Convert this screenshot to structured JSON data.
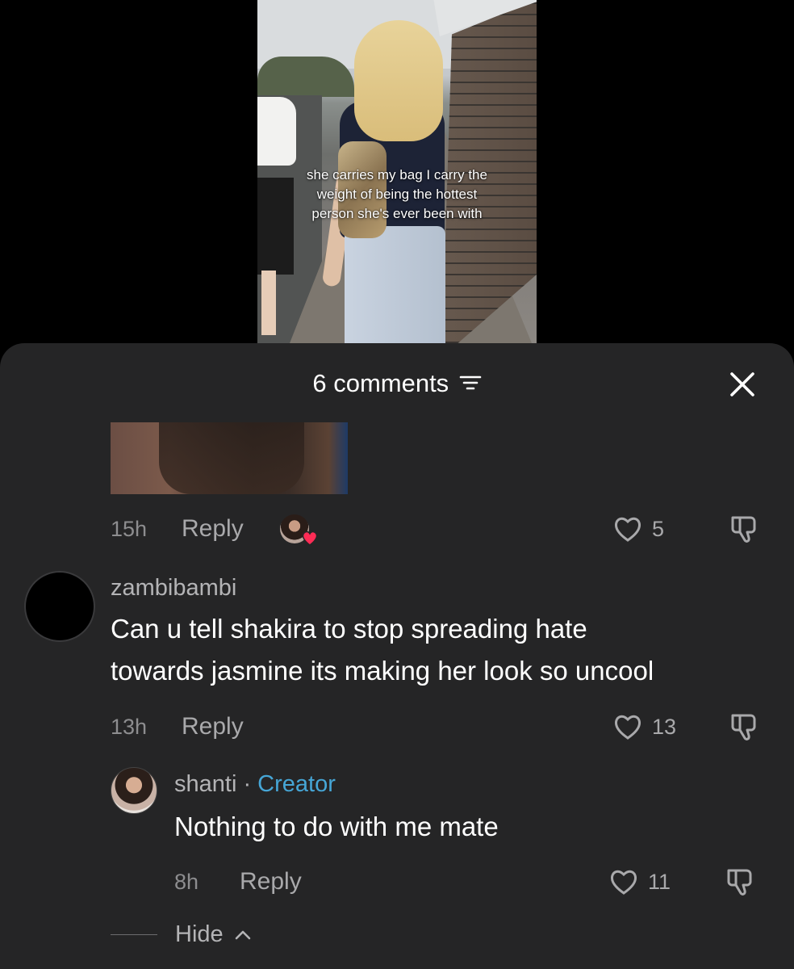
{
  "video": {
    "caption_lines": [
      "she carries my bag I carry the",
      "weight of being the hottest",
      "person she's ever been with"
    ]
  },
  "sheet": {
    "comment_count": "6 comments",
    "filter_icon": "filter-sort-icon",
    "close_icon": "close-icon"
  },
  "comments": [
    {
      "time": "15h",
      "reply_label": "Reply",
      "likes": "5",
      "liked_by_creator": true
    },
    {
      "username": "zambibambi",
      "text_lines": [
        "Can u tell shakira to stop spreading hate",
        "towards jasmine its making her look so uncool"
      ],
      "time": "13h",
      "reply_label": "Reply",
      "likes": "13",
      "replies": [
        {
          "username": "shanti",
          "separator": " · ",
          "badge": "Creator",
          "text": "Nothing to do with me mate",
          "time": "8h",
          "reply_label": "Reply",
          "likes": "11"
        }
      ]
    }
  ],
  "hide_label": "Hide",
  "colors": {
    "sheet_bg": "#252526",
    "creator_badge": "#46a6d6",
    "muted_text": "#a9a9ab",
    "heart_badge": "#fe2c55"
  }
}
